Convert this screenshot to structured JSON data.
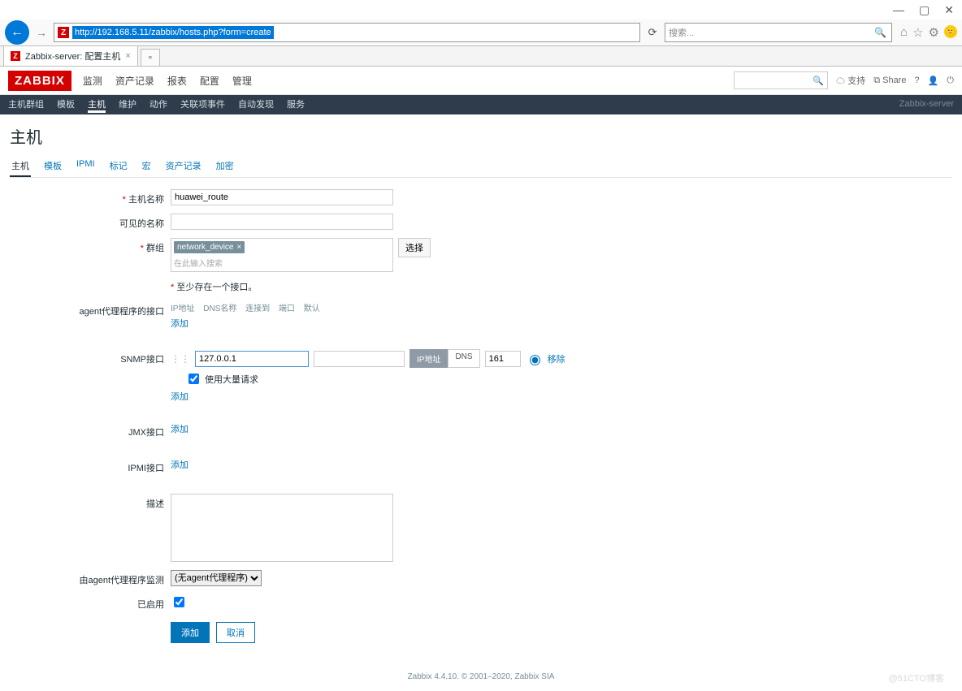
{
  "browser": {
    "url": "http://192.168.5.11/zabbix/hosts.php?form=create",
    "search_placeholder": "搜索...",
    "tab_title": "Zabbix-server: 配置主机"
  },
  "header": {
    "logo": "ZABBIX",
    "menu": [
      "监测",
      "资产记录",
      "报表",
      "配置",
      "管理"
    ],
    "support": "支持",
    "share": "Share"
  },
  "submenu": {
    "items": [
      "主机群组",
      "模板",
      "主机",
      "维护",
      "动作",
      "关联项事件",
      "自动发现",
      "服务"
    ],
    "active": 2,
    "right": "Zabbix-server"
  },
  "page_title": "主机",
  "ftabs": {
    "items": [
      "主机",
      "模板",
      "IPMI",
      "标记",
      "宏",
      "资产记录",
      "加密"
    ],
    "active": 0
  },
  "labels": {
    "host_name": "主机名称",
    "visible_name": "可见的名称",
    "groups": "群组",
    "groups_ph": "在此输入搜索",
    "select_btn": "选择",
    "need_iface": "至少存在一个接口。",
    "agent_if": "agent代理程序的接口",
    "snmp_if": "SNMP接口",
    "jmx_if": "JMX接口",
    "ipmi_if": "IPMI接口",
    "if_cols": {
      "ip": "IP地址",
      "dns": "DNS名称",
      "conn": "连接到",
      "port": "端口",
      "def": "默认"
    },
    "add": "添加",
    "bulk": "使用大量请求",
    "remove": "移除",
    "desc": "描述",
    "proxy": "由agent代理程序监测",
    "proxy_val": "(无agent代理程序)",
    "enabled": "已启用",
    "btn_add": "添加",
    "btn_cancel": "取消"
  },
  "values": {
    "host_name": "huawei_route",
    "visible_name": "",
    "group_tag": "network_device",
    "snmp_ip": "127.0.0.1",
    "snmp_port": "161",
    "seg_ip": "IP地址",
    "seg_dns": "DNS",
    "bulk_checked": true,
    "enabled_checked": true
  },
  "footer": "Zabbix 4.4.10. © 2001–2020, Zabbix SIA",
  "watermark": "@51CTO博客"
}
